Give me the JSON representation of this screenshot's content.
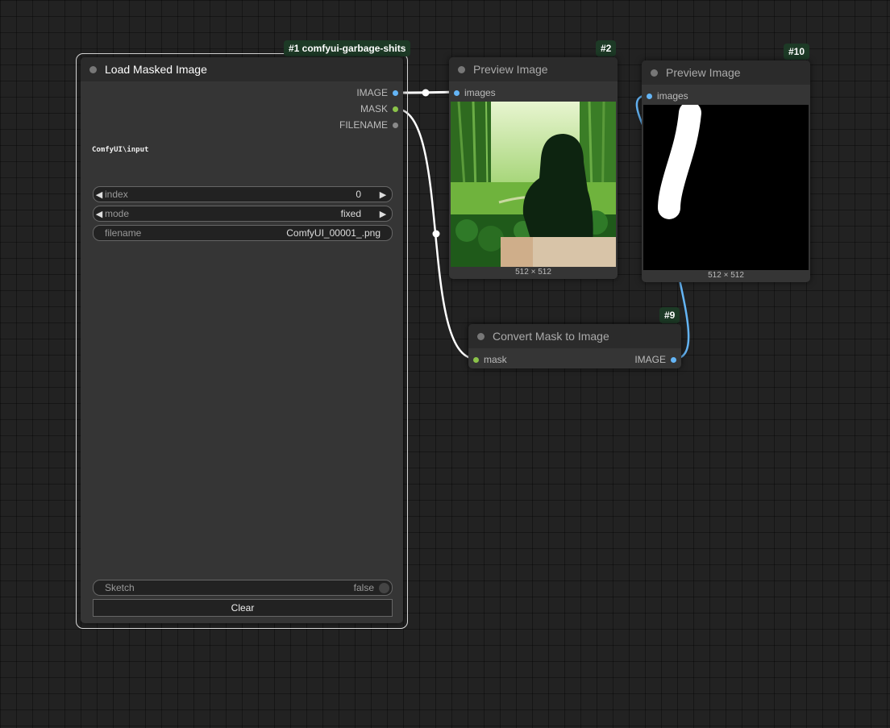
{
  "nodes": {
    "load": {
      "badge": "#1 comfyui-garbage-shits",
      "title": "Load Masked Image",
      "outputs": [
        "IMAGE",
        "MASK",
        "FILENAME"
      ],
      "path_label": "ComfyUI\\input",
      "index": {
        "label": "index",
        "value": "0"
      },
      "mode": {
        "label": "mode",
        "value": "fixed"
      },
      "filename": {
        "label": "filename",
        "value": "ComfyUI_00001_.png"
      },
      "sketch": {
        "label": "Sketch",
        "value": "false"
      },
      "clear_label": "Clear"
    },
    "preview1": {
      "badge": "#2",
      "title": "Preview Image",
      "input": "images",
      "size": "512 × 512"
    },
    "preview2": {
      "badge": "#10",
      "title": "Preview Image",
      "input": "images",
      "size": "512 × 512"
    },
    "convert": {
      "badge": "#9",
      "title": "Convert Mask to Image",
      "input": "mask",
      "output": "IMAGE"
    }
  },
  "colors": {
    "image_link": "#ffffff",
    "image_pin": "#64b5f6",
    "mask_pin": "#8bc34a",
    "blue_link": "#64b5f6"
  }
}
